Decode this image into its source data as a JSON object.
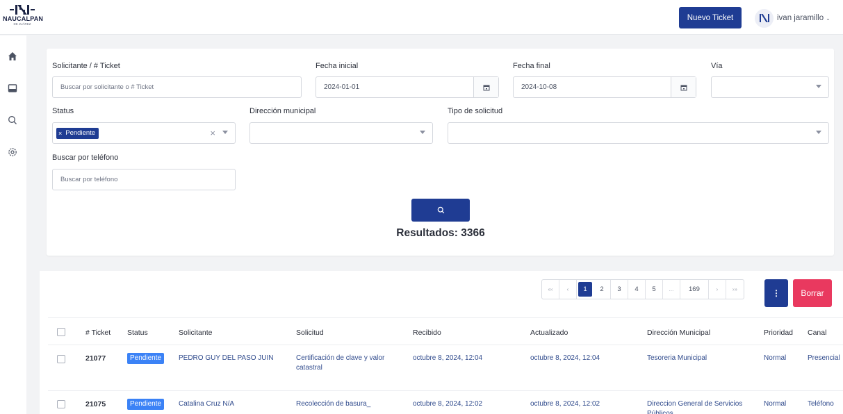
{
  "header": {
    "logo_name": "NAUCALPAN",
    "logo_sub": "DE JUÁREZ",
    "new_ticket": "Nuevo Ticket",
    "user_name": "ivan jaramillo",
    "caret": "⌄"
  },
  "sidebar": [
    "home-icon",
    "inbox-icon",
    "search-icon",
    "settings-icon"
  ],
  "filters": {
    "requester_label": "Solicitante / # Ticket",
    "requester_placeholder": "Buscar por solicitante o # Ticket",
    "start_label": "Fecha inicial",
    "start_value": "2024-01-01",
    "end_label": "Fecha final",
    "end_value": "2024-10-08",
    "via_label": "Vía",
    "status_label": "Status",
    "status_tag": "Pendiente",
    "status_tag_x": "×",
    "status_clear": "×",
    "direction_label": "Dirección municipal",
    "type_label": "Tipo de solicitud",
    "phone_label": "Buscar por teléfono",
    "phone_placeholder": "Buscar por teléfono",
    "results": "Resultados: 3366"
  },
  "pagination": {
    "first": "«‹",
    "prev": "‹",
    "pages": [
      "1",
      "2",
      "3",
      "4",
      "5",
      "...",
      "169"
    ],
    "next": "›",
    "last": "›»"
  },
  "actions": {
    "kebab": "⋮",
    "delete": "Borrar"
  },
  "table": {
    "headers": {
      "ticket": "# Ticket",
      "status": "Status",
      "requester": "Solicitante",
      "request": "Solicitud",
      "received": "Recibido",
      "updated": "Actualizado",
      "direction": "Dirección Municipal",
      "priority": "Prioridad",
      "channel": "Canal"
    },
    "rows": [
      {
        "ticket": "21077",
        "status": "Pendiente",
        "requester": "PEDRO GUY DEL PASO JUIN",
        "request": "Certificación de clave y valor catastral",
        "received": "octubre 8, 2024, 12:04",
        "updated": "octubre 8, 2024, 12:04",
        "direction": "Tesoreria Municipal",
        "priority": "Normal",
        "channel": "Presencial"
      },
      {
        "ticket": "21075",
        "status": "Pendiente",
        "requester": "Catalina Cruz N/A",
        "request": "Recolección de basura_",
        "received": "octubre 8, 2024, 12:02",
        "updated": "octubre 8, 2024, 12:02",
        "direction": "Direccion General de Servicios Públicos",
        "priority": "Normal",
        "channel": "Teléfono"
      }
    ]
  },
  "colors": {
    "primary": "#1f3c93",
    "danger": "#e9395f",
    "badge": "#3b82f6"
  }
}
